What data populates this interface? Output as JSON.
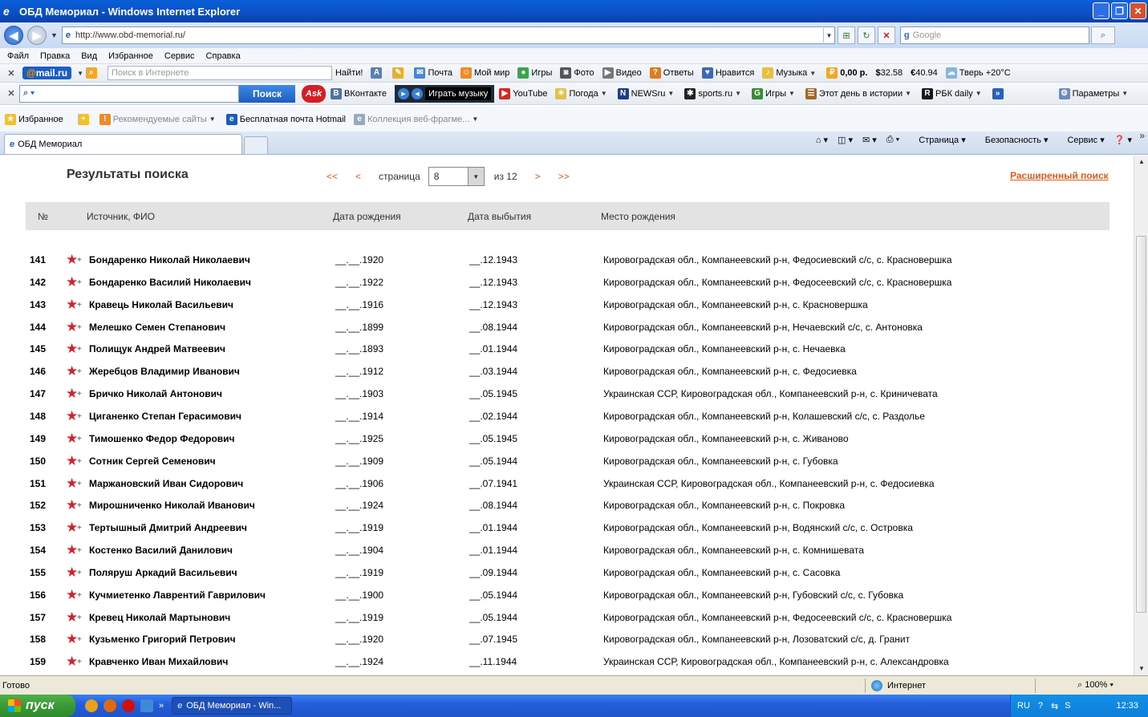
{
  "window": {
    "title": "ОБД Мемориал - Windows Internet Explorer",
    "minimize": "_",
    "maximize": "❐",
    "close": "✕"
  },
  "address": {
    "url": "http://www.obd-memorial.ru/",
    "search_placeholder": "Google"
  },
  "menu": [
    "Файл",
    "Правка",
    "Вид",
    "Избранное",
    "Сервис",
    "Справка"
  ],
  "mailbar": {
    "logo": "mail.ru",
    "search_placeholder": "Поиск в Интернете",
    "find": "Найти!",
    "items": [
      "Почта",
      "Мой мир",
      "Игры",
      "Фото",
      "Видео",
      "Ответы",
      "Нравится",
      "Музыка",
      "0,00 р.",
      "32.58",
      "40.94",
      "Тверь +20°C"
    ]
  },
  "askbar": {
    "search_button": "Поиск",
    "ask_logo": "Ask",
    "play_music": "Играть музыку",
    "items": [
      "ВКонтакте",
      "YouTube",
      "Погода",
      "NEWSru",
      "sports.ru",
      "Игры",
      "Этот день в истории",
      "РБК daily"
    ],
    "params": "Параметры"
  },
  "favbar": {
    "favorites": "Избранное",
    "recommended": "Рекомендуемые сайты",
    "hotmail": "Бесплатная почта Hotmail",
    "webslices": "Коллекция веб-фрагме..."
  },
  "tab": {
    "label": "ОБД Мемориал"
  },
  "commands": [
    "Страница",
    "Безопасность",
    "Сервис"
  ],
  "page": {
    "title": "Результаты поиска",
    "first": "<<",
    "prev": "<",
    "page_label": "страница",
    "page_value": "8",
    "of_label": "из 12",
    "next": ">",
    "last": ">>",
    "advanced_search": "Расширенный поиск"
  },
  "table": {
    "headers": [
      "№",
      "Источник, ФИО",
      "Дата рождения",
      "Дата выбытия",
      "Место рождения"
    ],
    "rows": [
      {
        "num": "141",
        "name": "Бондаренко Николай Николаевич",
        "birth": "__.__.1920",
        "depart": "__.12.1943",
        "place": "Кировоградская обл., Компанеевский р-н, Федосиевский с/с, с. Красновершка"
      },
      {
        "num": "142",
        "name": "Бондаренко Василий Николаевич",
        "birth": "__.__.1922",
        "depart": "__.12.1943",
        "place": "Кировоградская обл., Компанеевский р-н, Федосеевский с/с, с. Красновершка"
      },
      {
        "num": "143",
        "name": "Кравець Николай Васильевич",
        "birth": "__.__.1916",
        "depart": "__.12.1943",
        "place": "Кировоградская обл., Компанеевский р-н, с. Красновершка"
      },
      {
        "num": "144",
        "name": "Мелешко Семен Степанович",
        "birth": "__.__.1899",
        "depart": "__.08.1944",
        "place": "Кировоградская обл., Компанеевский р-н, Нечаевский с/с, с. Антоновка"
      },
      {
        "num": "145",
        "name": "Полищук Андрей Матвеевич",
        "birth": "__.__.1893",
        "depart": "__.01.1944",
        "place": "Кировоградская обл., Компанеевский р-н, с. Нечаевка"
      },
      {
        "num": "146",
        "name": "Жеребцов Владимир Иванович",
        "birth": "__.__.1912",
        "depart": "__.03.1944",
        "place": "Кировоградская обл., Компанеевский р-н, с. Федосиевка"
      },
      {
        "num": "147",
        "name": "Бричко Николай Антонович",
        "birth": "__.__.1903",
        "depart": "__.05.1945",
        "place": "Украинская ССР, Кировоградская обл., Компанеевский р-н, с. Криничевата"
      },
      {
        "num": "148",
        "name": "Циганенко Степан Герасимович",
        "birth": "__.__.1914",
        "depart": "__.02.1944",
        "place": "Кировоградская обл., Компанеевский р-н, Колашевский с/с, с. Раздолье"
      },
      {
        "num": "149",
        "name": "Тимошенко Федор Федорович",
        "birth": "__.__.1925",
        "depart": "__.05.1945",
        "place": "Кировоградская обл., Компанеевский р-н, с. Живаново"
      },
      {
        "num": "150",
        "name": "Сотник Сергей Семенович",
        "birth": "__.__.1909",
        "depart": "__.05.1944",
        "place": "Кировоградская обл., Компанеевский р-н, с. Губовка"
      },
      {
        "num": "151",
        "name": "Маржановский Иван Сидорович",
        "birth": "__.__.1906",
        "depart": "__.07.1941",
        "place": "Украинская ССР, Кировоградская обл., Компанеевский р-н, с. Федосиевка"
      },
      {
        "num": "152",
        "name": "Мирошниченко Николай Иванович",
        "birth": "__.__.1924",
        "depart": "__.08.1944",
        "place": "Кировоградская обл., Компанеевский р-н, с. Покровка"
      },
      {
        "num": "153",
        "name": "Тертышный Дмитрий Андреевич",
        "birth": "__.__.1919",
        "depart": "__.01.1944",
        "place": "Кировоградская обл., Компанеевский р-н, Водянский с/с, с. Островка"
      },
      {
        "num": "154",
        "name": "Костенко Василий Данилович",
        "birth": "__.__.1904",
        "depart": "__.01.1944",
        "place": "Кировоградская обл., Компанеевский р-н, с. Комнишевата"
      },
      {
        "num": "155",
        "name": "Поляруш Аркадий Васильевич",
        "birth": "__.__.1919",
        "depart": "__.09.1944",
        "place": "Кировоградская обл., Компанеевский р-н, с. Сасовка"
      },
      {
        "num": "156",
        "name": "Кучмиетенко Лаврентий Гаврилович",
        "birth": "__.__.1900",
        "depart": "__.05.1944",
        "place": "Кировоградская обл., Компанеевский р-н, Губовский с/с, с. Губовка"
      },
      {
        "num": "157",
        "name": "Кревец Николай Мартынович",
        "birth": "__.__.1919",
        "depart": "__.05.1944",
        "place": "Кировоградская обл., Компанеевский р-н, Федосеевский с/с, с. Красновершка"
      },
      {
        "num": "158",
        "name": "Кузьменко Григорий Петрович",
        "birth": "__.__.1920",
        "depart": "__.07.1945",
        "place": "Кировоградская обл., Компанеевский р-н, Лозоватский с/с, д. Гранит"
      },
      {
        "num": "159",
        "name": "Кравченко Иван Михайлович",
        "birth": "__.__.1924",
        "depart": "__.11.1944",
        "place": "Украинская ССР, Кировоградская обл., Компанеевский р-н, с. Александровка"
      }
    ]
  },
  "status": {
    "text": "Готово",
    "zone": "Интернет",
    "zoom": "100%"
  },
  "taskbar": {
    "start": "пуск",
    "task": "ОБД Мемориал - Win...",
    "lang": "RU",
    "clock": "12:33"
  }
}
